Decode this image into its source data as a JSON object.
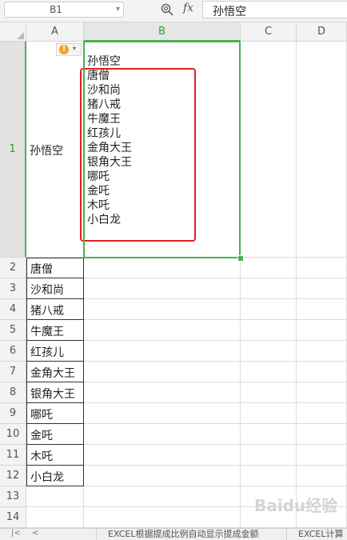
{
  "formula_bar": {
    "name_box": "B1",
    "formula": "孙悟空",
    "zoom_icon": "zoom-icon",
    "fx_label": "fx"
  },
  "columns": [
    "A",
    "B",
    "C",
    "D"
  ],
  "rows": [
    "1",
    "2",
    "3",
    "4",
    "5",
    "6",
    "7",
    "8",
    "9",
    "10",
    "11",
    "12",
    "13",
    "14"
  ],
  "cells": {
    "A1": "孙悟空",
    "A_list": [
      "唐僧",
      "沙和尚",
      "猪八戒",
      "牛魔王",
      "红孩儿",
      "金角大王",
      "银角大王",
      "哪吒",
      "金吒",
      "木吒",
      "小白龙"
    ],
    "B1": "孙悟空\n唐僧\n沙和尚\n猪八戒\n牛魔王\n红孩儿\n金角大王\n银角大王\n哪吒\n金吒\n木吒\n小白龙"
  },
  "selection": {
    "cell": "B1",
    "color": "#4caf50"
  },
  "highlight_color": "#e02020",
  "warning_icon": "!",
  "sheet_tabs": [
    "EXCEL根据提成比例自动显示提成金额",
    "EXCEL计算"
  ],
  "watermark": "Baidu经验"
}
